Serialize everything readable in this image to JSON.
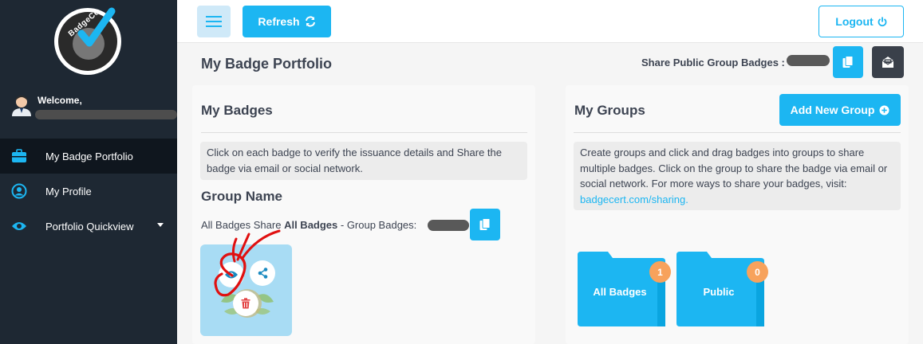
{
  "sidebar": {
    "logo_text": "BadgeCert",
    "welcome": "Welcome,",
    "items": [
      {
        "label": "My Badge Portfolio",
        "icon": "briefcase-icon",
        "active": true
      },
      {
        "label": "My Profile",
        "icon": "user-circle-icon",
        "active": false
      },
      {
        "label": "Portfolio Quickview",
        "icon": "eye-icon",
        "active": false,
        "has_dropdown": true
      }
    ]
  },
  "topbar": {
    "menu_icon": "hamburger-icon",
    "refresh_label": "Refresh",
    "logout_label": "Logout"
  },
  "page": {
    "title": "My Badge Portfolio",
    "share_public_label": "Share Public Group Badges :"
  },
  "my_badges": {
    "title": "My Badges",
    "info": "Click on each badge to verify the issuance details and Share the badge via email or social network.",
    "group_name_heading": "Group Name",
    "share_prefix": "All Badges Share ",
    "share_bold": "All Badges",
    "share_suffix": " - Group Badges:"
  },
  "my_groups": {
    "title": "My Groups",
    "add_button_label": "Add New Group",
    "info": "Create groups and click and drag badges into groups to share multiple badges. Click on the group to share the badge via email or social network. For more ways to share your badges, visit:",
    "info_link": "badgecert.com/sharing.",
    "groups": [
      {
        "name": "All Badges",
        "count": "1"
      },
      {
        "name": "Public",
        "count": "0"
      }
    ]
  },
  "colors": {
    "accent": "#1cb6f2",
    "sidebar_bg": "#1e2833",
    "badge_count": "#f7a25c",
    "annotation": "#e01010"
  }
}
